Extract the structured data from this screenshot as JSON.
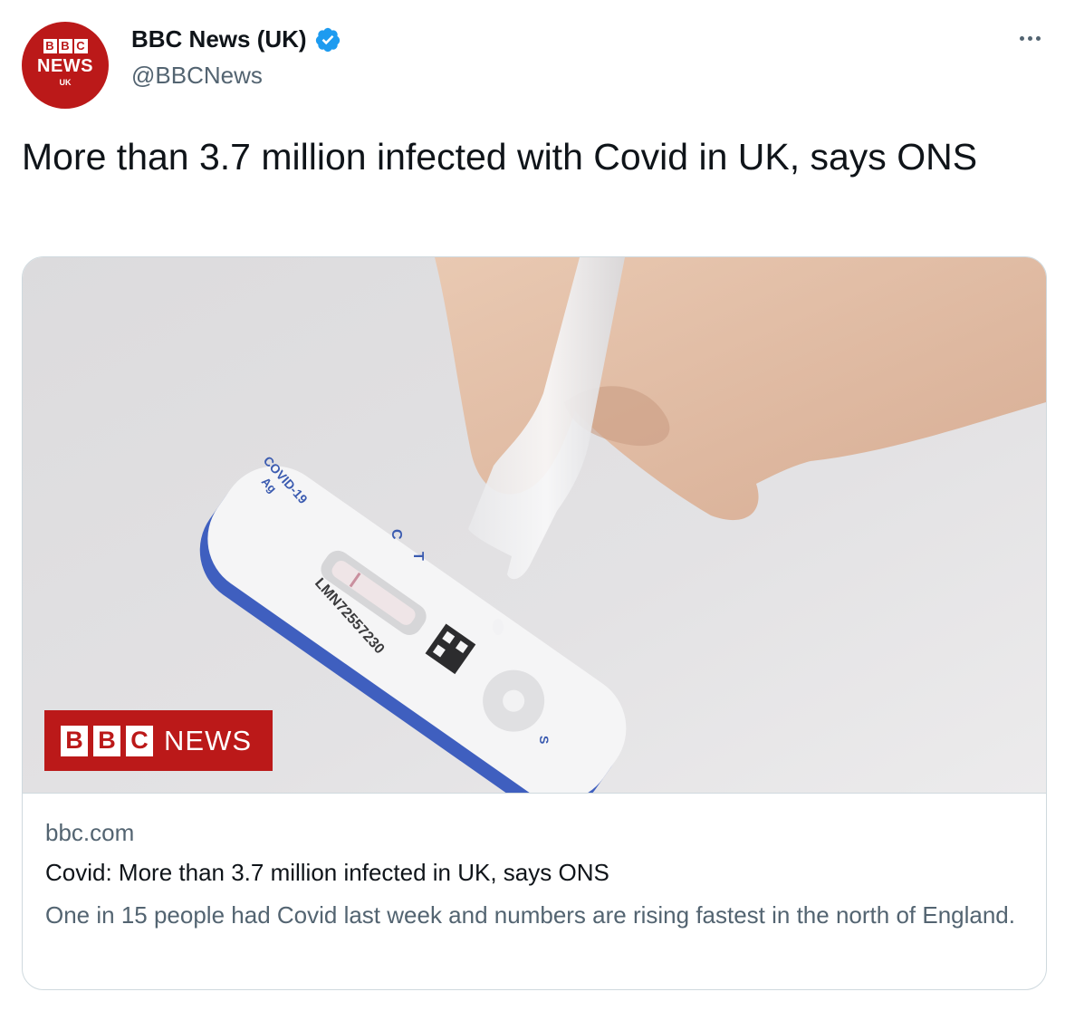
{
  "author": {
    "avatar_top": "BBC",
    "avatar_middle": "NEWS",
    "avatar_bottom": "UK",
    "name": "BBC News (UK)",
    "handle": "@BBCNews",
    "verified": true
  },
  "tweet": {
    "text": "More than 3.7 million infected with Covid in UK, says ONS"
  },
  "link_card": {
    "domain": "bbc.com",
    "title": "Covid: More than 3.7 million infected in UK, says ONS",
    "description": "One in 15 people had Covid last week and numbers are rising fastest in the north of England.",
    "image_logo_blocks": [
      "B",
      "B",
      "C"
    ],
    "image_logo_text": "NEWS",
    "image_test_text": "COVID-19",
    "image_test_sub": "Ag",
    "image_test_c": "C",
    "image_test_t": "T",
    "image_test_s": "S",
    "image_test_code": "LMN72557230"
  },
  "colors": {
    "bbc_red": "#bb1919",
    "verified_blue": "#1d9bf0",
    "secondary_text": "#536471"
  },
  "icons": {
    "verified": "verified-badge-icon",
    "more": "more-options-icon"
  }
}
